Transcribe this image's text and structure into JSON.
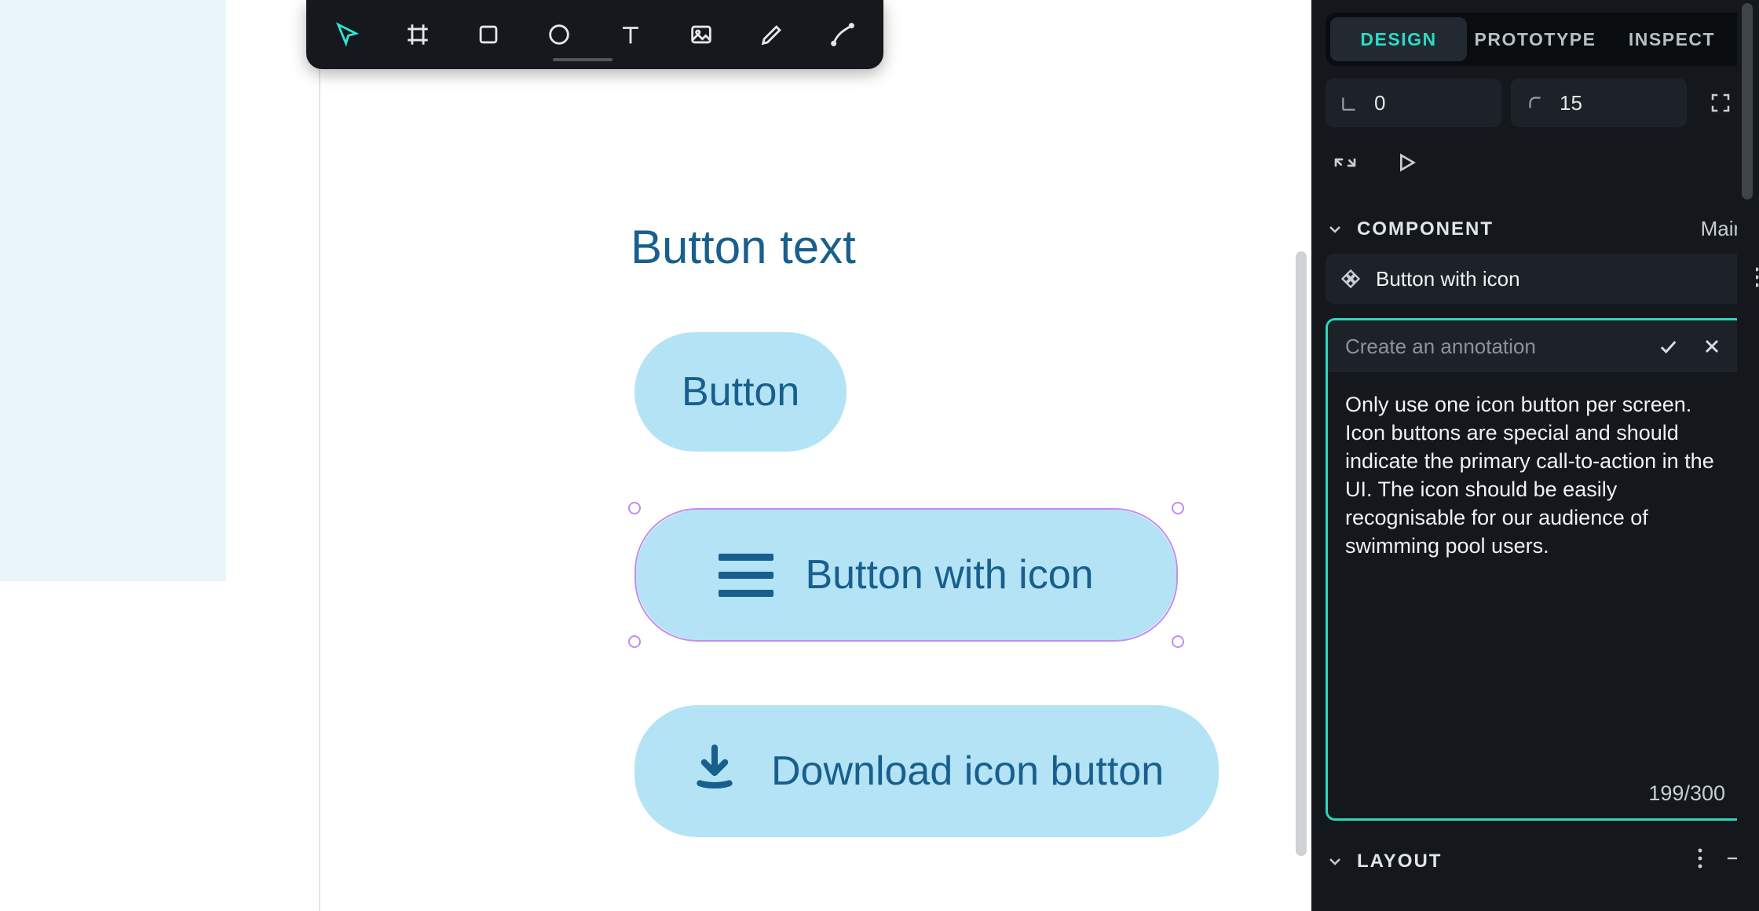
{
  "toolbar": {
    "tools": [
      "move",
      "frame",
      "rectangle",
      "ellipse",
      "text",
      "image",
      "pencil",
      "pen"
    ]
  },
  "canvas": {
    "frame_title": "Button text",
    "buttons": {
      "b1": "Button",
      "b2": "Button with icon",
      "b3": "Download icon button"
    }
  },
  "inspector": {
    "tabs": {
      "design": "DESIGN",
      "prototype": "PROTOTYPE",
      "inspect": "INSPECT"
    },
    "rotation": "0",
    "radius": "15",
    "component": {
      "section_title": "COMPONENT",
      "main_label": "Main",
      "name": "Button with icon"
    },
    "annotation": {
      "placeholder": "Create an annotation",
      "text": "Only use one icon button per screen. Icon buttons are special and should indicate the primary call-to-action in the UI. The icon should be easily recognisable for our audience of swimming pool users.",
      "count": "199/300"
    },
    "layout": {
      "section_title": "LAYOUT"
    }
  }
}
